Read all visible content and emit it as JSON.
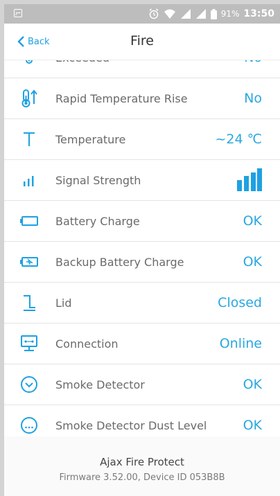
{
  "status_bar": {
    "battery": "91%",
    "time": "13:50"
  },
  "header": {
    "back_label": "Back",
    "title": "Fire"
  },
  "rows": [
    {
      "label": "Exceeded",
      "value": "No",
      "icon": "thermometer-alert-icon"
    },
    {
      "label": "Rapid Temperature Rise",
      "value": "No",
      "icon": "thermometer-rise-icon"
    },
    {
      "label": "Temperature",
      "value": "~24 ℃",
      "icon": "temperature-t-icon"
    },
    {
      "label": "Signal Strength",
      "value": "",
      "icon": "signal-bars-icon"
    },
    {
      "label": "Battery Charge",
      "value": "OK",
      "icon": "battery-icon"
    },
    {
      "label": "Backup Battery Charge",
      "value": "OK",
      "icon": "backup-battery-icon"
    },
    {
      "label": "Lid",
      "value": "Closed",
      "icon": "lid-icon"
    },
    {
      "label": "Connection",
      "value": "Online",
      "icon": "connection-icon"
    },
    {
      "label": "Smoke Detector",
      "value": "OK",
      "icon": "smoke-detector-icon"
    },
    {
      "label": "Smoke Detector Dust Level",
      "value": "OK",
      "icon": "dust-level-icon"
    }
  ],
  "footer": {
    "device_name": "Ajax Fire Protect",
    "firmware": "Firmware 3.52.00, Device ID 053B8B"
  },
  "colors": {
    "accent": "#1da1e2",
    "status_bar": "#bdbdbd"
  }
}
